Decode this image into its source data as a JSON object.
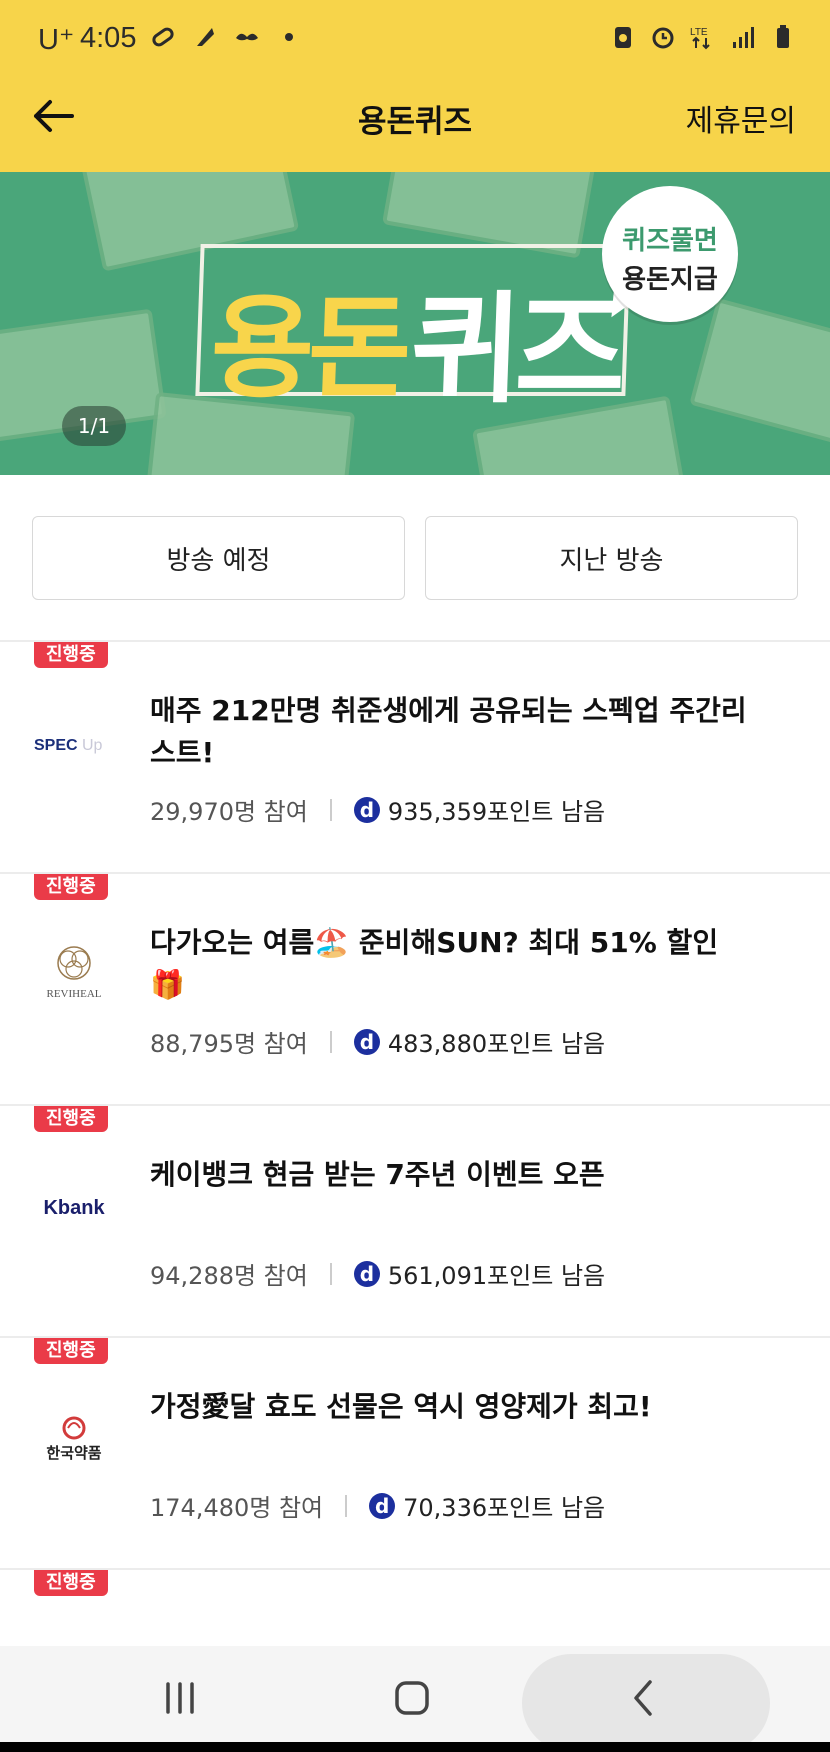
{
  "status_bar": {
    "carrier": "U⁺",
    "time": "4:05"
  },
  "header": {
    "title": "용돈퀴즈",
    "back_icon": "arrow-left-icon",
    "partner_label": "제휴문의"
  },
  "banner": {
    "title_part1": "용돈",
    "title_part2": "퀴즈",
    "bubble_line1": "퀴즈풀면",
    "bubble_line2": "용돈지급",
    "bill_text": "용돈퀴즈",
    "pager": "1/1"
  },
  "tabs": [
    {
      "label": "방송 예정"
    },
    {
      "label": "지난 방송"
    }
  ],
  "items": [
    {
      "badge": "진행중",
      "logo_text": "SPEC Up",
      "title": "매주 212만명 취준생에게 공유되는 스펙업 주간리스트!",
      "participants": "29,970명 참여",
      "points": "935,359포인트 남음"
    },
    {
      "badge": "진행중",
      "logo_text": "REVIHEAL",
      "title": "다가오는 여름🏖️ 준비해SUN? 최대 51% 할인🎁",
      "participants": "88,795명 참여",
      "points": "483,880포인트 남음"
    },
    {
      "badge": "진행중",
      "logo_text": "Kbank",
      "title": "케이뱅크 현금 받는 7주년 이벤트 오픈",
      "participants": "94,288명 참여",
      "points": "561,091포인트 남음"
    },
    {
      "badge": "진행중",
      "logo_text": "한국약품",
      "title": "가정愛달 효도 선물은 역시 영양제가 최고!",
      "participants": "174,480명 참여",
      "points": "70,336포인트 남음"
    },
    {
      "badge": "진행중"
    }
  ],
  "colors": {
    "header_bg": "#f7d44a",
    "banner_bg": "#4aa67a",
    "badge_bg": "#ea3b48",
    "coin": "#1c2f9e"
  },
  "nav": {
    "recent_icon": "recent-apps-icon",
    "home_icon": "home-icon",
    "back_icon": "back-chevron-icon"
  }
}
